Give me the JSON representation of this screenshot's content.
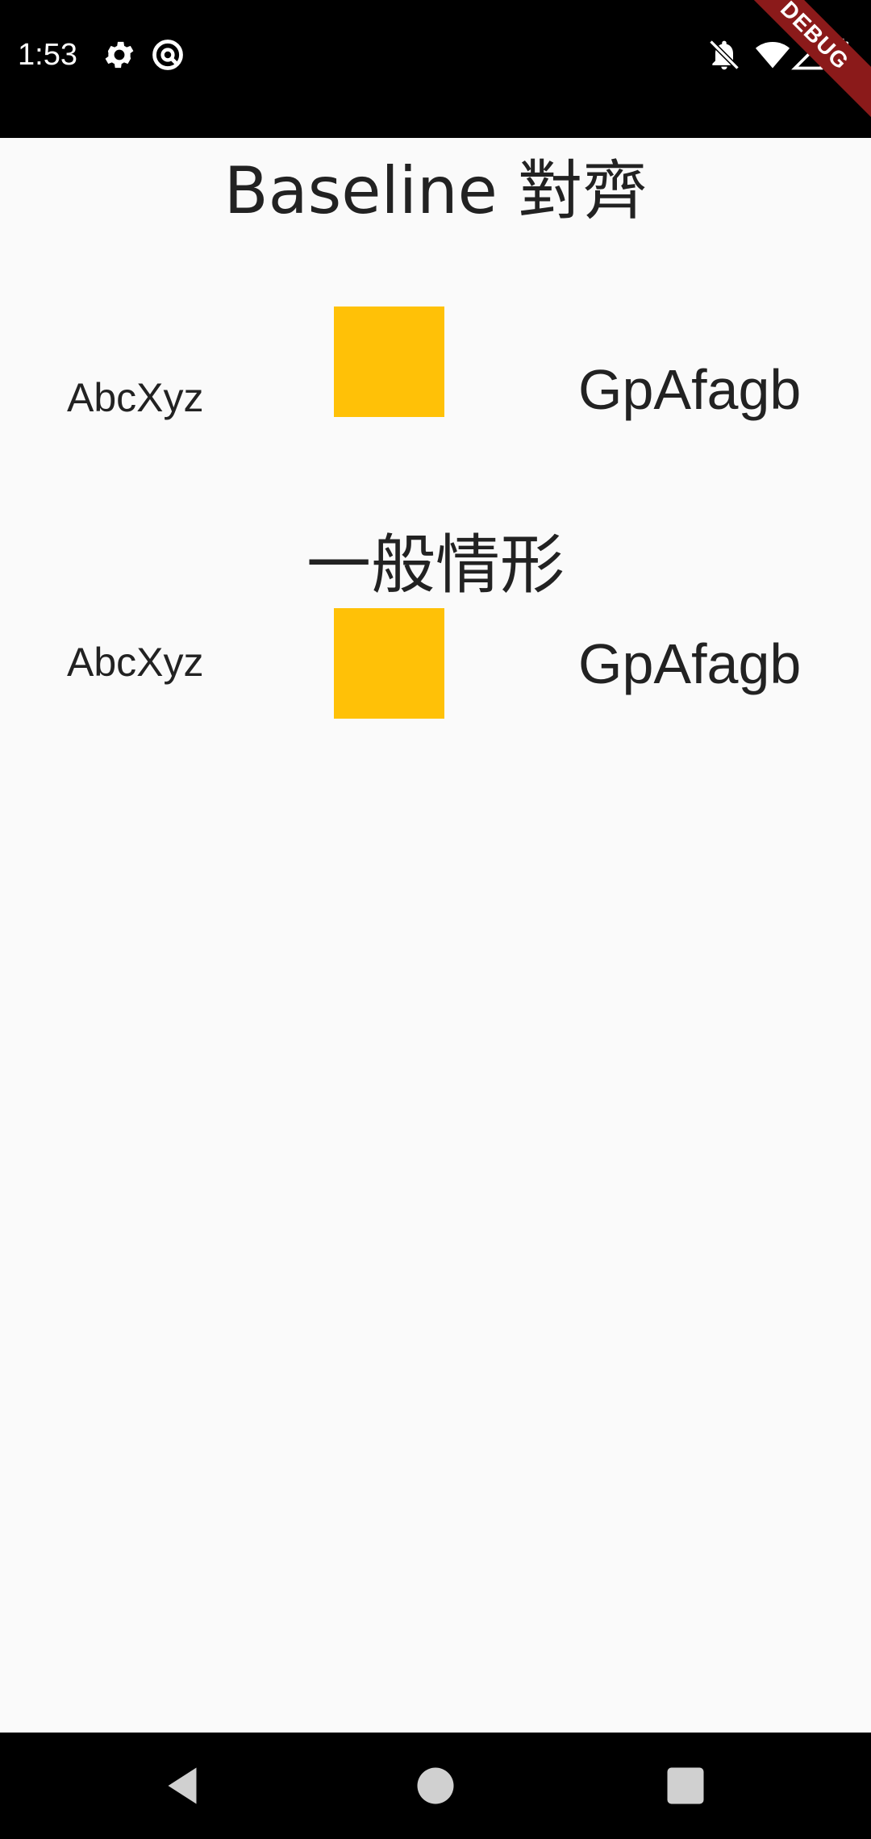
{
  "status_bar": {
    "time": "1:53",
    "debug_label": "DEBUG",
    "icons": [
      "settings-icon",
      "data-saver-icon",
      "notifications-off-icon",
      "wifi-icon",
      "signal-icon",
      "battery-icon"
    ]
  },
  "sections": {
    "baseline": {
      "title": "Baseline 對齊",
      "left_text": "AbcXyz",
      "right_text": "GpAfagb"
    },
    "normal": {
      "title": "一般情形",
      "left_text": "AbcXyz",
      "right_text": "GpAfagb"
    }
  },
  "colors": {
    "box": "#ffc107",
    "text": "#222222",
    "background": "#fafafa",
    "debug_banner": "#8b1a1a"
  },
  "nav_bar": {
    "icons": [
      "back-icon",
      "home-icon",
      "recents-icon"
    ]
  }
}
